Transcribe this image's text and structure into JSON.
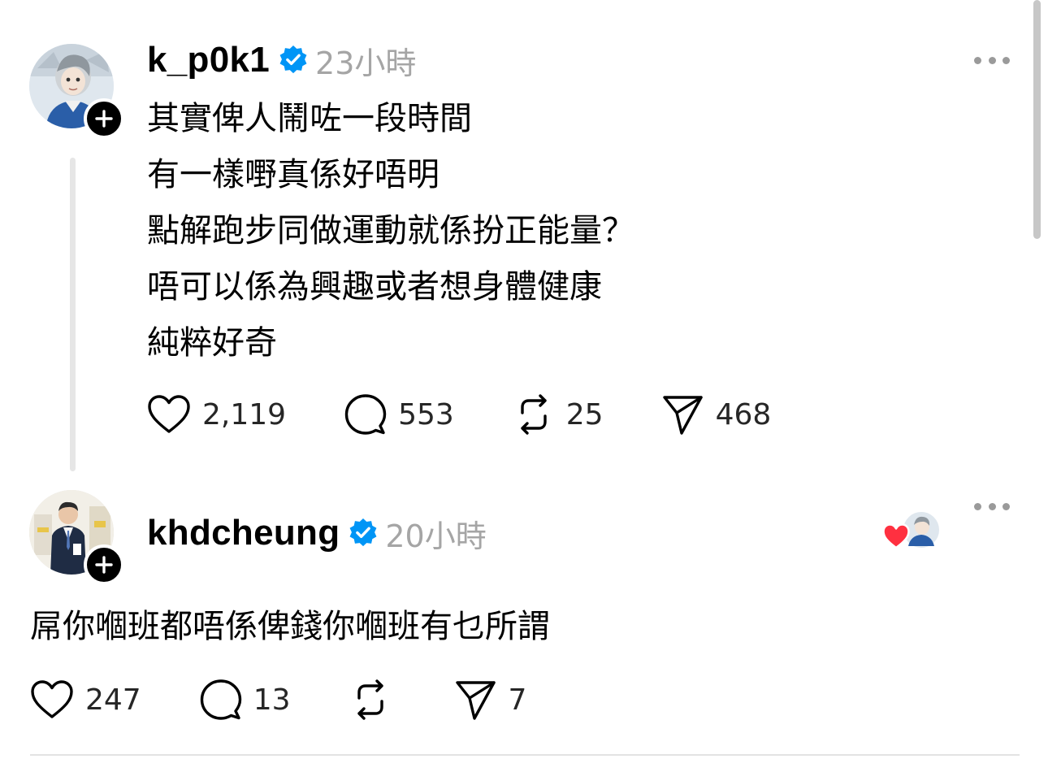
{
  "post": {
    "username": "k_p0k1",
    "timestamp": "23小時",
    "avatar_icon": "anime-character-avatar",
    "lines": [
      "其實俾人鬧咗一段時間",
      "有一樣嘢真係好唔明",
      "點解跑步同做運動就係扮正能量？",
      "唔可以係為興趣或者想身體健康",
      "純粹好奇"
    ],
    "likes": "2,119",
    "replies": "553",
    "reposts": "25",
    "shares": "468"
  },
  "reply": {
    "username": "khdcheung",
    "timestamp": "20小時",
    "avatar_icon": "man-in-suit-avatar",
    "text": "屌你嗰班都唔係俾錢你嗰班有乜所謂",
    "likes": "247",
    "replies": "13",
    "reposts": "",
    "shares": "7",
    "liked_by_author_icon": "heart-icon"
  },
  "colors": {
    "verified": "#0095f6",
    "timestamp": "#a5a5a5",
    "liked_heart": "#ff3040",
    "thread_line": "#e6e6e6"
  }
}
